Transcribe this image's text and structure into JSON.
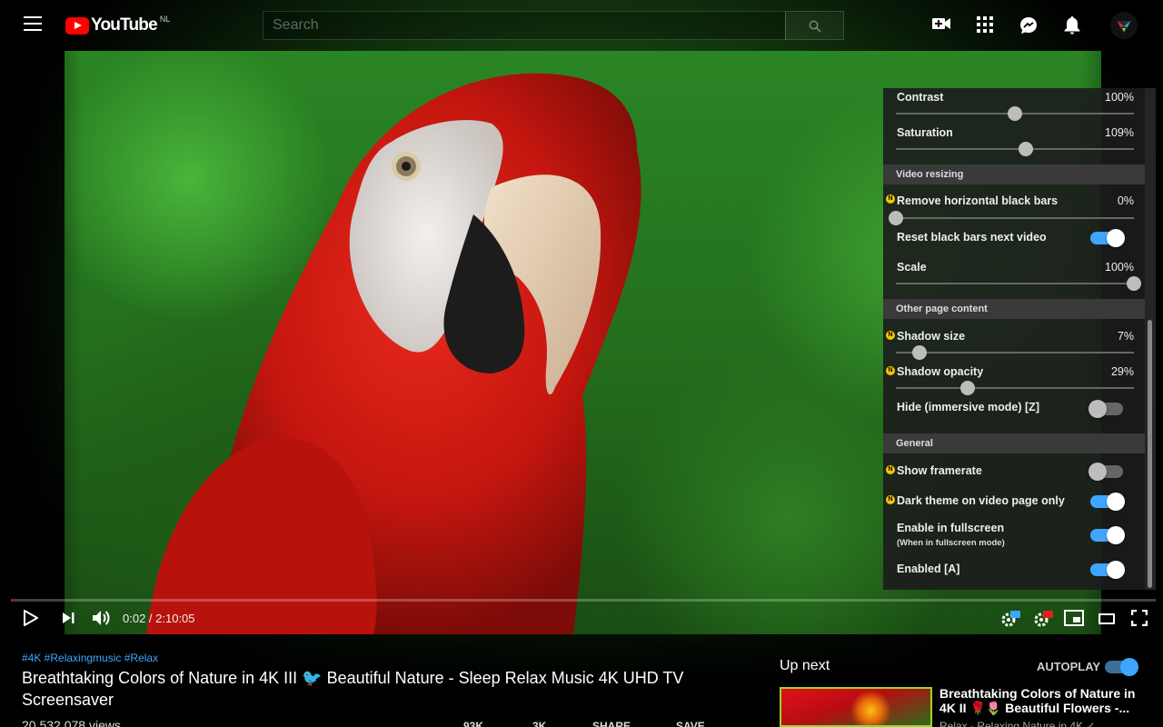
{
  "topbar": {
    "logo_text": "YouTube",
    "region": "NL",
    "search_placeholder": "Search"
  },
  "player": {
    "time": "0:02 / 2:10:05",
    "progress": 0.0003
  },
  "panel": {
    "rows": [
      {
        "label": "Contrast",
        "value": "100%",
        "level": 0.5
      },
      {
        "label": "Saturation",
        "value": "109%",
        "level": 0.545
      }
    ],
    "sections": {
      "video_resizing": "Video resizing",
      "other_page_content": "Other page content",
      "general": "General"
    },
    "remove_black_bars": {
      "label": "Remove horizontal black bars",
      "value": "0%",
      "level": 0
    },
    "reset_black_bars": {
      "label": "Reset black bars next video",
      "on": true
    },
    "scale": {
      "label": "Scale",
      "value": "100%",
      "level": 1
    },
    "shadow_size": {
      "label": "Shadow size",
      "value": "7%",
      "level": 0.1
    },
    "shadow_opacity": {
      "label": "Shadow opacity",
      "value": "29%",
      "level": 0.3
    },
    "hide_immersive": {
      "label": "Hide (immersive mode) [Z]",
      "on": false
    },
    "show_framerate": {
      "label": "Show framerate",
      "on": false
    },
    "dark_theme": {
      "label": "Dark theme on video page only",
      "on": true
    },
    "enable_fullscreen": {
      "label": "Enable in fullscreen",
      "sub": "(When in fullscreen mode)",
      "on": true
    },
    "enabled": {
      "label": "Enabled [A]",
      "on": true
    },
    "badge": "N"
  },
  "video_info": {
    "tags": "#4K #Relaxingmusic #Relax",
    "title": "Breathtaking Colors of Nature in 4K III 🐦 Beautiful Nature - Sleep Relax Music 4K UHD TV Screensaver",
    "views": "20,532,078 views",
    "likes": "93K",
    "dislikes": "3K",
    "share": "SHARE",
    "save": "SAVE"
  },
  "sidebar": {
    "up_next": "Up next",
    "autoplay": "AUTOPLAY",
    "rec_title": "Breathtaking Colors of Nature in 4K II 🌹🌷 Beautiful Flowers -...",
    "rec_channel": "Relax - Relaxing Nature in 4K ✓"
  },
  "colors": {
    "accent": "#3ea6ff",
    "brand": "#ff0000",
    "badge": "#f5c400"
  }
}
